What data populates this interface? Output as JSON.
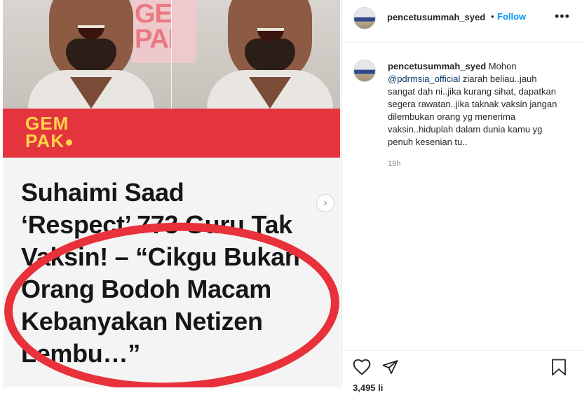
{
  "media": {
    "logo_watermark": "GEM PAK",
    "banner_logo_line1": "GEM",
    "banner_logo_line2": "PAK",
    "headline_lines": [
      "Suhaimi Saad",
      "‘Respect’ 773 Guru Tak",
      "Vaksin! – “Cikgu Bukan",
      "Orang Bodoh Macam",
      "Kebanyakan Netizen",
      "Lembu…”"
    ],
    "next_icon": "chevron-right-icon"
  },
  "header": {
    "username": "pencetusummah_syed",
    "separator": "•",
    "follow_label": "Follow",
    "more_icon": "more-options-icon"
  },
  "caption": {
    "username": "pencetusummah_syed",
    "text_before_mention": "Mohon",
    "mention": "@pdrmsia_official",
    "text_after_mention": "ziarah beliau..jauh sangat dah ni..jika kurang sihat, dapatkan segera rawatan..jika taknak vaksin jangan dilembukan orang yg menerima vaksin..hiduplah dalam dunia kamu yg penuh kesenian tu..",
    "time_ago": "19h"
  },
  "actions": {
    "like_icon": "heart-icon",
    "share_icon": "paper-plane-icon",
    "save_icon": "bookmark-icon",
    "likes_partial": "3,495 li"
  },
  "colors": {
    "accent_blue": "#0095f6",
    "banner_red": "#e4353f",
    "logo_yellow": "#ffd24a",
    "circle_red": "#e8313a"
  }
}
